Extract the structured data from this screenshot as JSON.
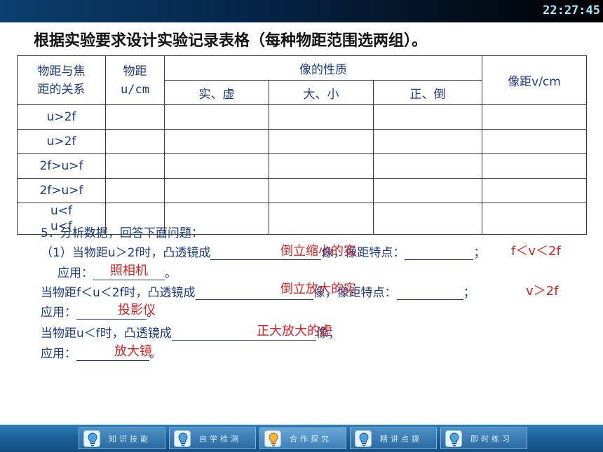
{
  "clock": "22:27:45",
  "title": "根据实验要求设计实验记录表格（每种物距范围选两组）。",
  "table": {
    "h_relation": "物距与焦距的关系",
    "h_relation_l1": "物距与焦",
    "h_relation_l2": "距的关系",
    "h_u_l1": "物距",
    "h_u_l2": "u/cm",
    "h_nature": "像的性质",
    "h_real": "实、虚",
    "h_size": "大、小",
    "h_orient": "正、倒",
    "h_v": "像距v/cm",
    "rows": [
      "u>2f",
      "u>2f",
      "2f>u>f",
      "2f>u>f",
      "u<f",
      "u<f"
    ]
  },
  "qa": {
    "heading": "5．分析数据，回答下面问题：",
    "l1_prefix": "（1）当物距u＞2f时，凸透镜成",
    "l1_ans": "倒立缩小的实",
    "l1_mid": "像，像距特点：",
    "l1_ans2": "f＜v＜2f",
    "l1_end": "；",
    "l2_prefix": "应用：",
    "l2_ans": "照相机",
    "l2_end": "。",
    "l3_prefix": "当物距f＜u＜2f时，凸透镜成",
    "l3_ans": "倒立放大的实",
    "l3_mid": "像，像距特点：",
    "l3_ans2": "v＞2f",
    "l3_end": "；",
    "l4_prefix": "应用：",
    "l4_ans": "投影仪",
    "l4_end": "。",
    "l5_prefix": "当物距u＜f时，凸透镜成",
    "l5_ans": "正大放大的虚",
    "l5_end": "像；",
    "l6_prefix": "应用：",
    "l6_ans": "放大镜",
    "l6_end": "。"
  },
  "nav": [
    "知识技能",
    "自学检测",
    "合作探究",
    "精讲点拨",
    "即时练习"
  ],
  "colors": {
    "text_blue": "#1a3a8a",
    "answer_red": "#e02020",
    "taskbar": "#1a5f98"
  }
}
